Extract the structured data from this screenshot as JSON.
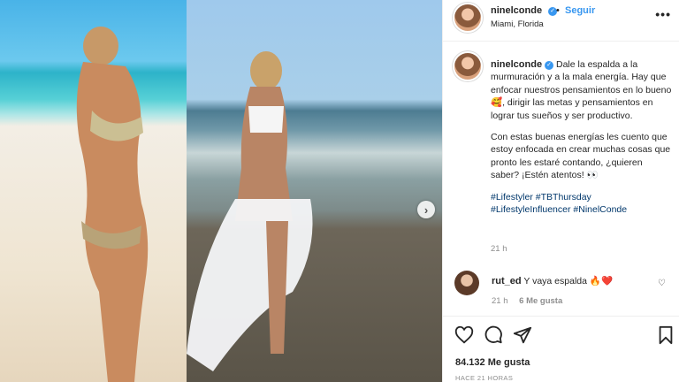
{
  "post": {
    "username": "ninelconde",
    "follow_label": "Seguir",
    "location": "Miami, Florida",
    "more_label": "•••",
    "caption_lines": [
      "Dale la espalda a la murmuración y a la mala energía. Hay que enfocar nuestros pensamientos en lo bueno 🥰, dirigir las metas y pensamientos en lograr tus sueños y ser productivo.",
      "Con estas buenas energías les cuento que estoy enfocada en crear muchas cosas que pronto les estaré contando, ¿quieren saber? ¡Estén atentos! 👀"
    ],
    "hashtags": [
      "#Lifestyler",
      "#TBThursday",
      "#LifestyleInfluencer",
      "#NinelConde"
    ],
    "caption_time": "21 h",
    "likes_count": "84.132 Me gusta",
    "posted_ago": "HACE 21 HORAS"
  },
  "comment": {
    "username": "rut_ed",
    "text": "Y vaya espalda 🔥❤️",
    "time": "21 h",
    "likes": "6 Me gusta"
  },
  "icons": {
    "verified": "verified-badge-icon",
    "next": "chevron-right-icon",
    "heart": "heart-icon",
    "comment": "comment-icon",
    "share": "share-icon",
    "save": "bookmark-icon"
  },
  "colors": {
    "link_blue": "#3897f0",
    "hashtag": "#00376b",
    "muted": "#8e8e8e"
  }
}
